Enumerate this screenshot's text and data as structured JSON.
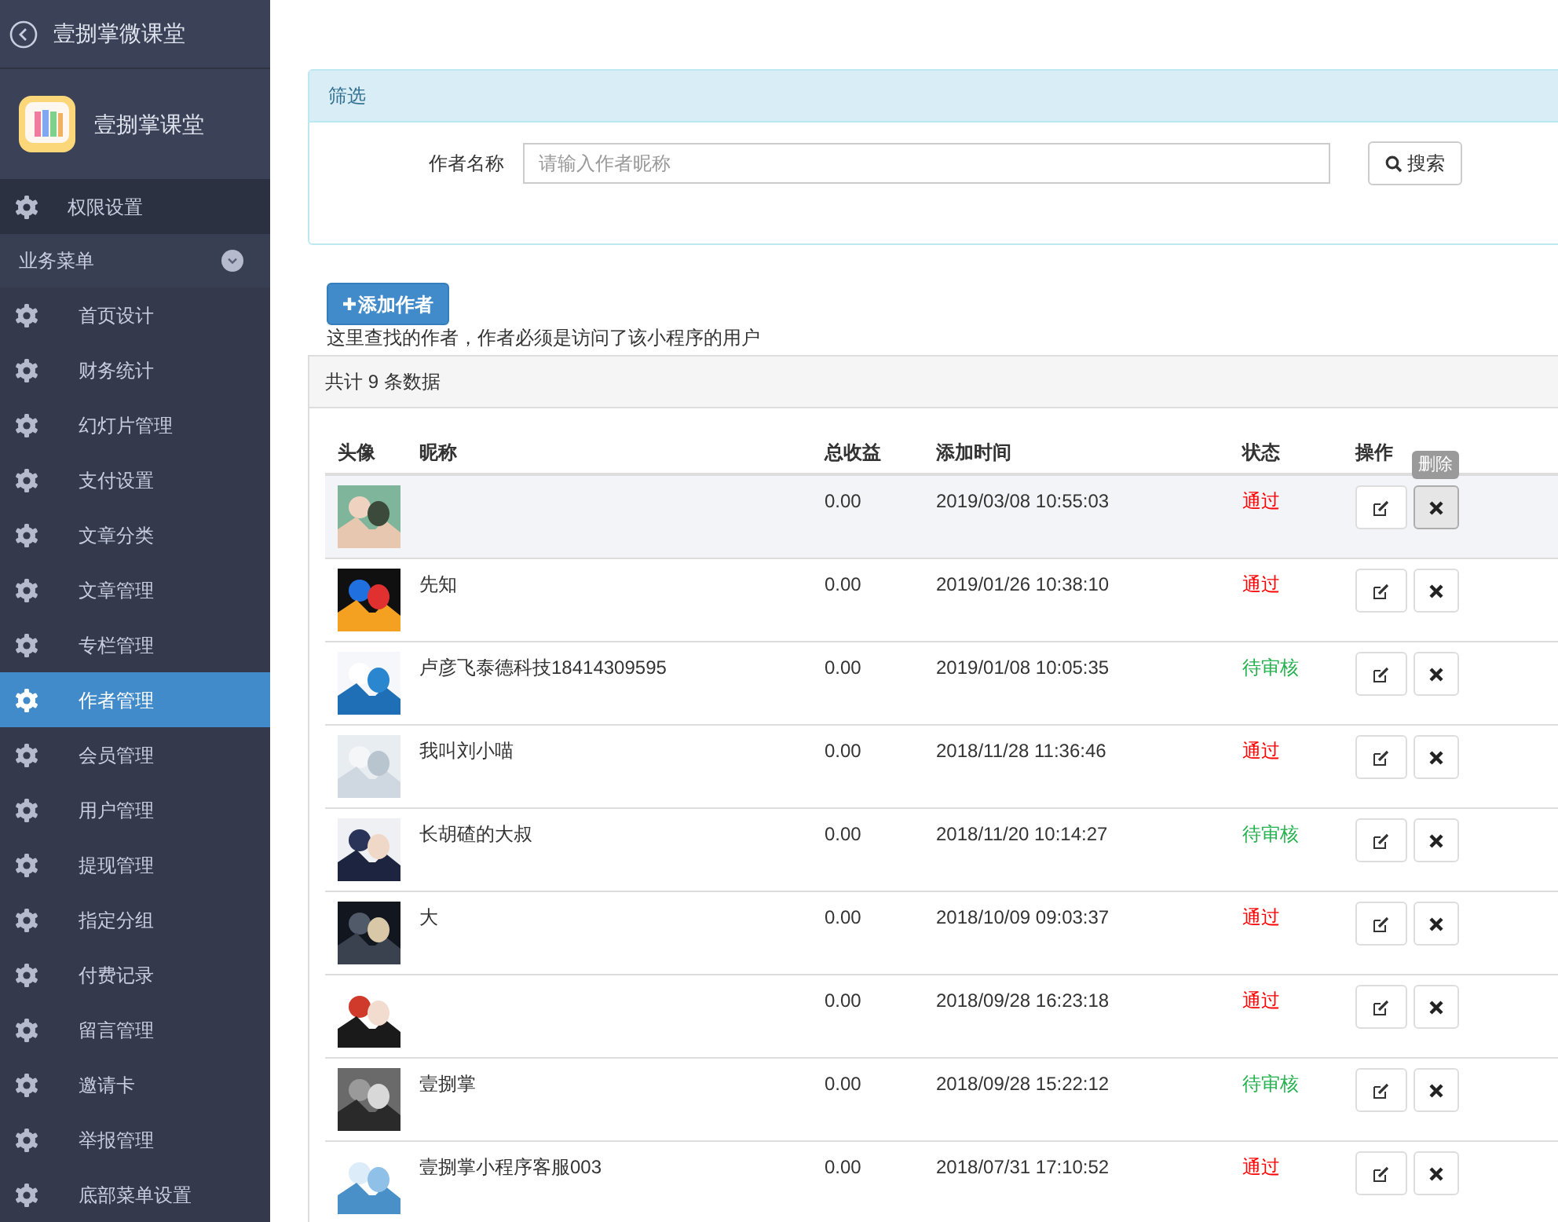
{
  "sidebar": {
    "title": "壹捌掌微课堂",
    "app_name": "壹捌掌课堂",
    "top_items": [
      {
        "label": "权限设置",
        "selected": false
      }
    ],
    "group": {
      "label": "业务菜单",
      "expanded": true,
      "items": [
        {
          "label": "首页设计",
          "selected": false
        },
        {
          "label": "财务统计",
          "selected": false
        },
        {
          "label": "幻灯片管理",
          "selected": false
        },
        {
          "label": "支付设置",
          "selected": false
        },
        {
          "label": "文章分类",
          "selected": false
        },
        {
          "label": "文章管理",
          "selected": false
        },
        {
          "label": "专栏管理",
          "selected": false
        },
        {
          "label": "作者管理",
          "selected": true
        },
        {
          "label": "会员管理",
          "selected": false
        },
        {
          "label": "用户管理",
          "selected": false
        },
        {
          "label": "提现管理",
          "selected": false
        },
        {
          "label": "指定分组",
          "selected": false
        },
        {
          "label": "付费记录",
          "selected": false
        },
        {
          "label": "留言管理",
          "selected": false
        },
        {
          "label": "邀请卡",
          "selected": false
        },
        {
          "label": "举报管理",
          "selected": false
        },
        {
          "label": "底部菜单设置",
          "selected": false
        }
      ]
    }
  },
  "filter": {
    "title": "筛选",
    "field_label": "作者名称",
    "placeholder": "请输入作者昵称",
    "search_button": "搜索"
  },
  "add_button": "添加作者",
  "hint": "这里查找的作者，作者必须是访问了该小程序的用户",
  "count": "共计 9 条数据",
  "table": {
    "columns": [
      "头像",
      "昵称",
      "总收益",
      "添加时间",
      "状态",
      "操作"
    ],
    "rows": [
      {
        "nickname": "",
        "income": "0.00",
        "time": "2019/03/08 10:55:03",
        "status": {
          "kind": "approved",
          "label": "通过"
        },
        "hovered": true,
        "tooltip": "删除"
      },
      {
        "nickname": "先知",
        "income": "0.00",
        "time": "2019/01/26 10:38:10",
        "status": {
          "kind": "approved",
          "label": "通过"
        },
        "hovered": false
      },
      {
        "nickname": "卢彦飞泰德科技18414309595",
        "income": "0.00",
        "time": "2019/01/08 10:05:35",
        "status": {
          "kind": "pending",
          "label": "待审核"
        },
        "hovered": false
      },
      {
        "nickname": "我叫刘小喵",
        "income": "0.00",
        "time": "2018/11/28 11:36:46",
        "status": {
          "kind": "approved",
          "label": "通过"
        },
        "hovered": false
      },
      {
        "nickname": "长胡碴的大叔",
        "income": "0.00",
        "time": "2018/11/20 10:14:27",
        "status": {
          "kind": "pending",
          "label": "待审核"
        },
        "hovered": false
      },
      {
        "nickname": "大",
        "income": "0.00",
        "time": "2018/10/09 09:03:37",
        "status": {
          "kind": "approved",
          "label": "通过"
        },
        "hovered": false
      },
      {
        "nickname": "",
        "income": "0.00",
        "time": "2018/09/28 16:23:18",
        "status": {
          "kind": "approved",
          "label": "通过"
        },
        "hovered": false
      },
      {
        "nickname": "壹捌掌",
        "income": "0.00",
        "time": "2018/09/28 15:22:12",
        "status": {
          "kind": "pending",
          "label": "待审核"
        },
        "hovered": false
      },
      {
        "nickname": "壹捌掌小程序客服003",
        "income": "0.00",
        "time": "2018/07/31 17:10:52",
        "status": {
          "kind": "approved",
          "label": "通过"
        },
        "hovered": false
      }
    ]
  }
}
